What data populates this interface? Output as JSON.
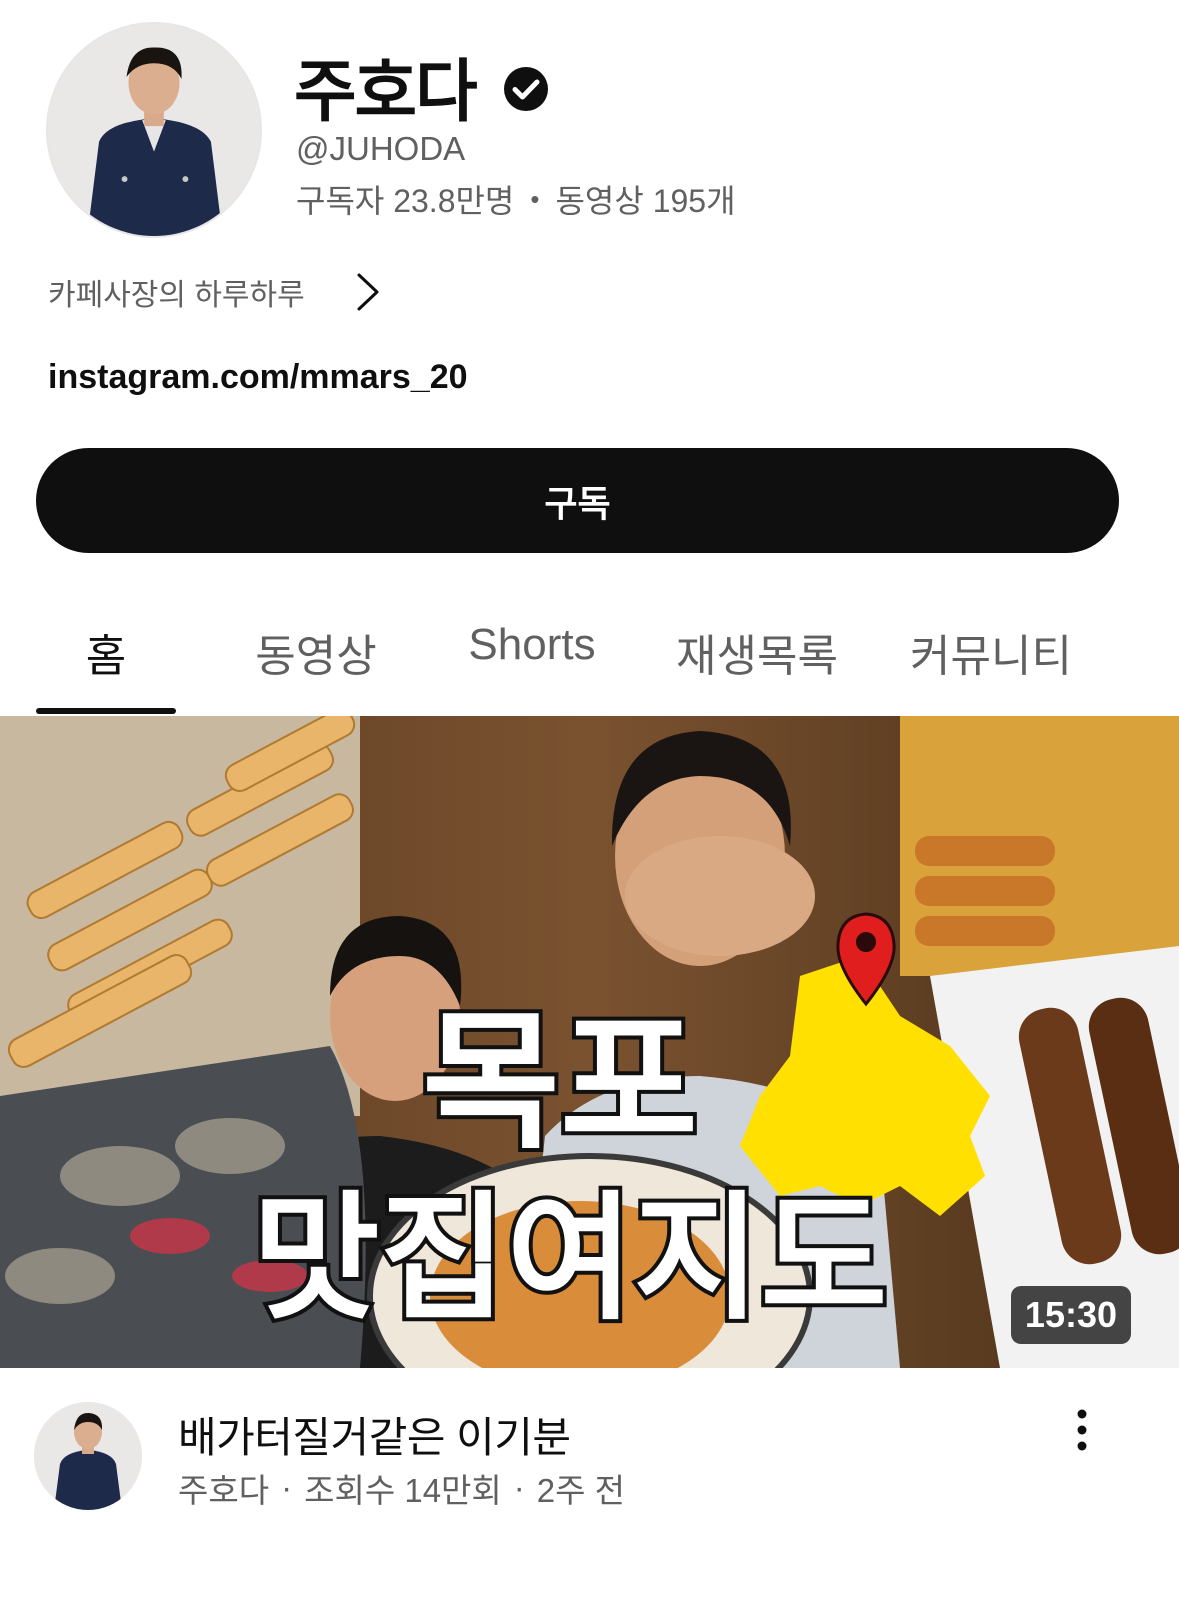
{
  "channel": {
    "name": "주호다",
    "handle": "@JUHODA",
    "subscribers": "구독자 23.8만명",
    "stats_separator": "•",
    "videos_count": "동영상 195개",
    "description": "카페사장의 하루하루",
    "link": "instagram.com/mmars_20",
    "subscribe_label": "구독",
    "verified_icon": "verified-check-icon"
  },
  "tabs": [
    {
      "label": "홈",
      "active": true
    },
    {
      "label": "동영상",
      "active": false
    },
    {
      "label": "Shorts",
      "active": false
    },
    {
      "label": "재생목록",
      "active": false
    },
    {
      "label": "커뮤니티",
      "active": false
    }
  ],
  "featured_video": {
    "thumbnail_text_line1": "목포",
    "thumbnail_text_line2": "맛집여지도",
    "duration": "15:30",
    "title": "배가터질거같은 이기분",
    "channel_name": "주호다",
    "views": "조회수 14만회",
    "age": "2주 전",
    "meta_separator": "·"
  },
  "colors": {
    "subscribe_bg": "#0f0f0f",
    "text_secondary": "#606060",
    "map_yellow": "#ffe000",
    "pin_red": "#e01e1e"
  }
}
